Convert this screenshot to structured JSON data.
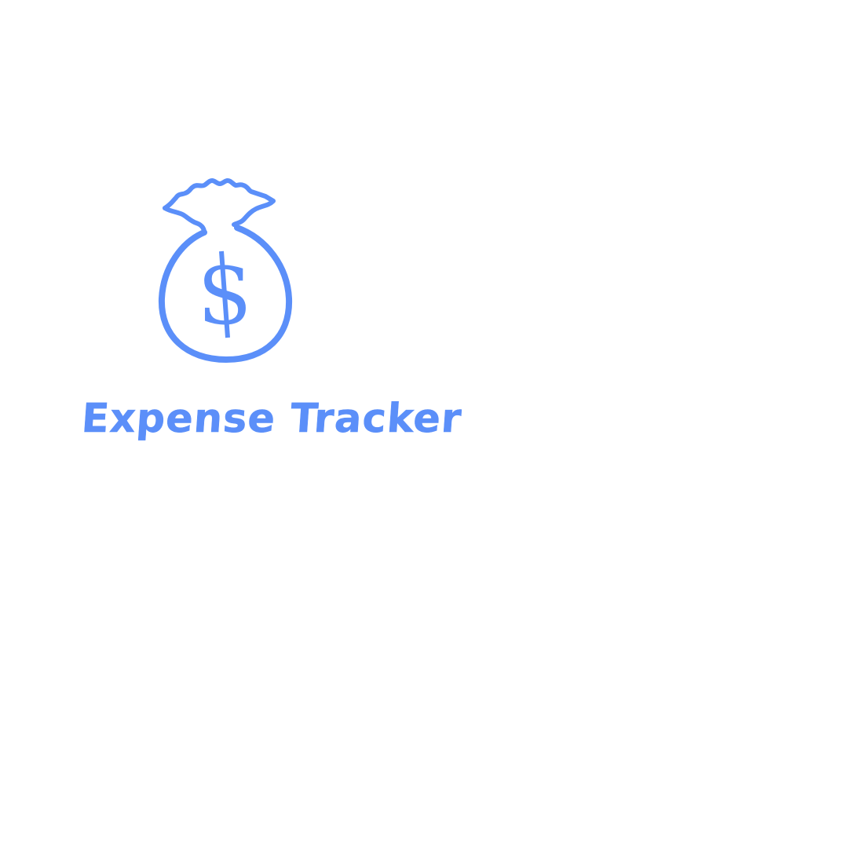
{
  "app": {
    "title": "Expense Tracker",
    "logo_icon": "money-bag-dollar-icon",
    "accent_color": "#5b8ff9",
    "background_color": "#ffffff"
  }
}
